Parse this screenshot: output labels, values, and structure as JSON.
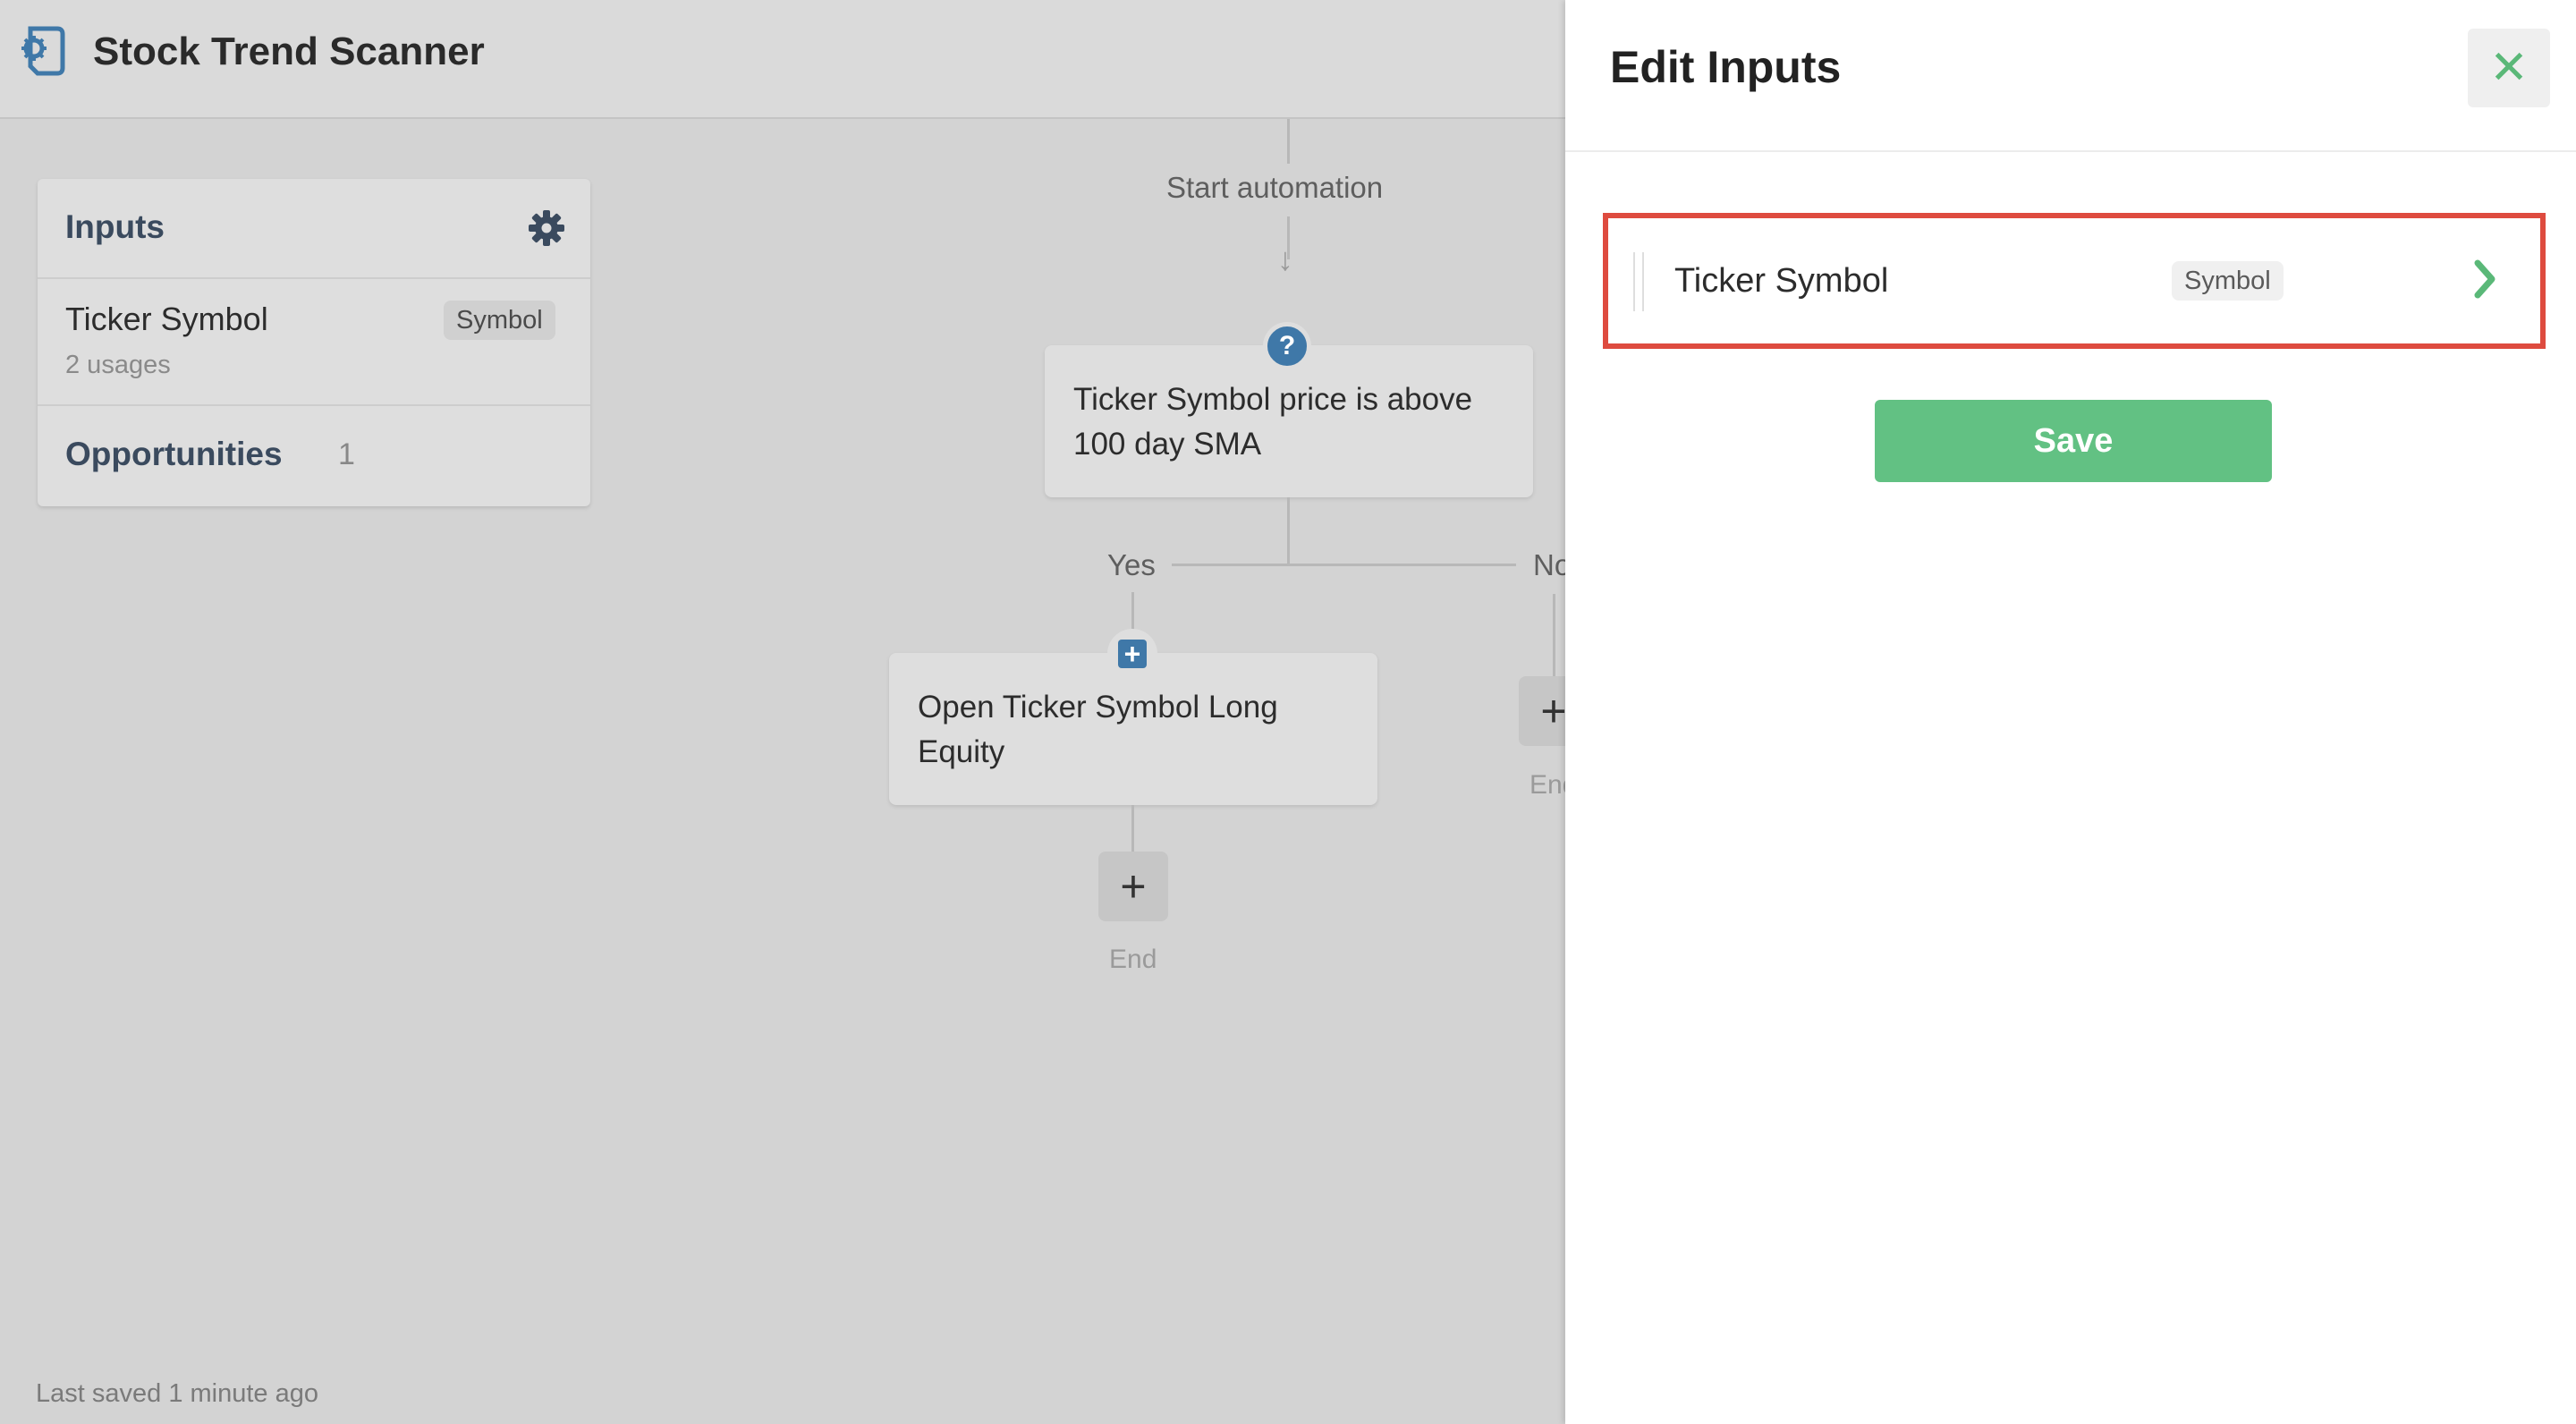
{
  "app": {
    "title": "Stock Trend Scanner",
    "icon": "document-gear-icon",
    "footer": "Last saved 1 minute ago"
  },
  "inputs_card": {
    "title": "Inputs",
    "settings_icon": "gear-icon",
    "items": [
      {
        "name": "Ticker Symbol",
        "type": "Symbol",
        "usage": "2 usages"
      }
    ],
    "opportunities_label": "Opportunities",
    "opportunities_count": "1"
  },
  "flow": {
    "start_label": "Start automation",
    "condition_text_line1": "Ticker Symbol price is above",
    "condition_text_line2": "100 day SMA",
    "yes_label": "Yes",
    "no_label": "No",
    "action_text_line1": "Open Ticker Symbol Long",
    "action_text_line2": "Equity",
    "add_symbol": "+",
    "end_label": "End"
  },
  "panel": {
    "title": "Edit Inputs",
    "close_symbol": "✕",
    "inputs": [
      {
        "name": "Ticker Symbol",
        "type": "Symbol"
      }
    ],
    "save_label": "Save"
  },
  "colors": {
    "accent_green": "#62c183",
    "highlight_red": "#de4b3f",
    "node_blue": "#3f78a8"
  }
}
